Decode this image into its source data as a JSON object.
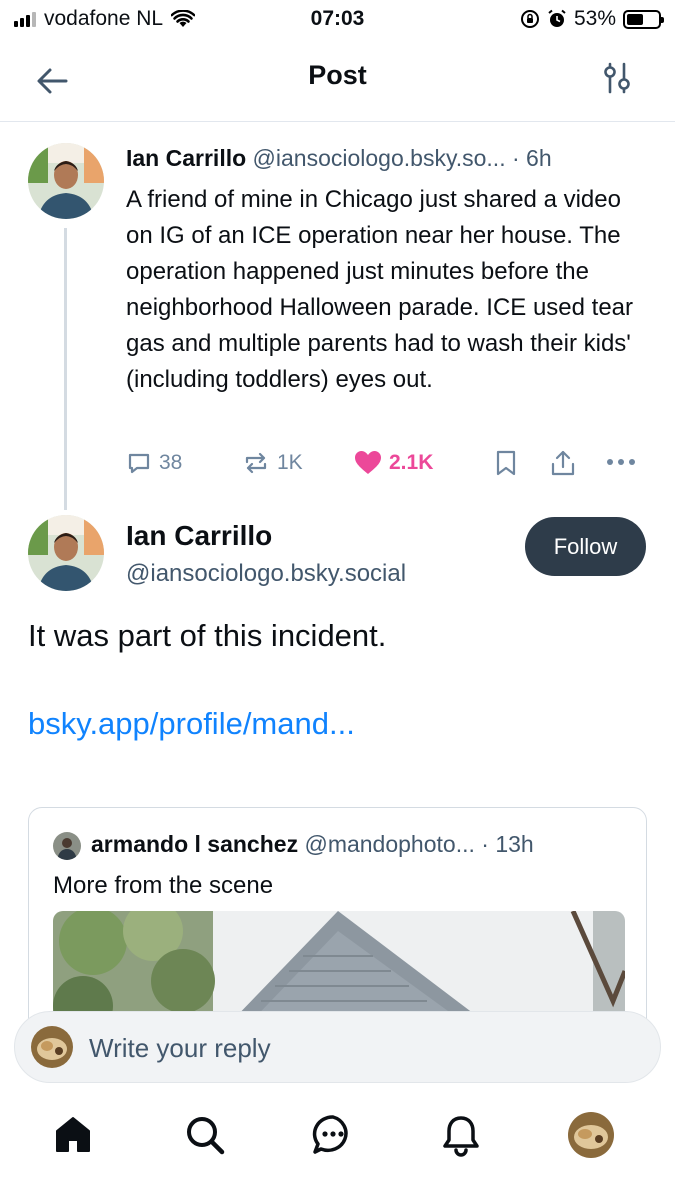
{
  "status_bar": {
    "carrier": "vodafone NL",
    "time": "07:03",
    "battery": "53%",
    "battery_level": 0.53
  },
  "header": {
    "title": "Post",
    "back_icon": "arrow-left-icon",
    "filter_icon": "sliders-icon"
  },
  "parent_post": {
    "author_name": "Ian Carrillo",
    "author_handle": "@iansociologo.bsky.so...",
    "separator": "·",
    "age": "6h",
    "text": "A friend of mine in Chicago just shared a video on IG of an ICE operation near her house. The operation happened just minutes before the neighborhood Halloween parade. ICE used tear gas and multiple parents had to wash their kids' (including toddlers) eyes out.",
    "reply_count": "38",
    "repost_count": "1K",
    "like_count": "2.1K"
  },
  "main_post": {
    "author_name": "Ian Carrillo",
    "author_handle": "@iansociologo.bsky.social",
    "follow_label": "Follow",
    "text": "It was part of this incident.",
    "link_text": "bsky.app/profile/mand..."
  },
  "quoted_post": {
    "author_name": "armando l sanchez",
    "author_handle": "@mandophoto...",
    "separator": "·",
    "age": "13h",
    "text": "More from the scene"
  },
  "reply_bar": {
    "placeholder": "Write your reply"
  },
  "tab_bar": {
    "items": [
      "home-icon",
      "search-icon",
      "chat-icon",
      "bell-icon",
      "profile-avatar"
    ]
  },
  "colors": {
    "like": "#ec4899",
    "link": "#1083fe",
    "muted": "#42576c",
    "follow_bg": "#2e3c4a"
  }
}
